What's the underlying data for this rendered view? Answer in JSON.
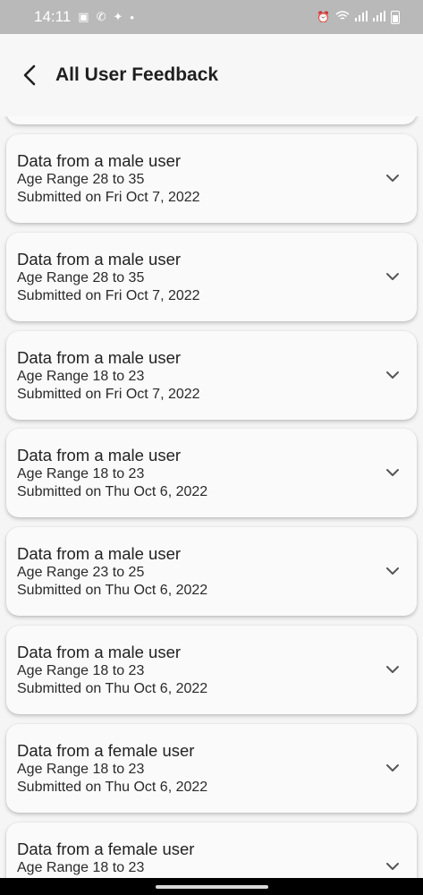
{
  "status_bar": {
    "time": "14:11",
    "left_icons": [
      "gallery-icon",
      "whatsapp-icon",
      "twitter-icon",
      "dot-icon"
    ],
    "right_icons": [
      "alarm-icon",
      "wifi-icon",
      "signal-icon",
      "signal-icon",
      "battery-charging-icon"
    ]
  },
  "app_bar": {
    "title": "All User Feedback",
    "back_icon": "chevron-left-icon"
  },
  "feedback_list": [
    {
      "title": "Data from a male user",
      "age": "Age Range 28 to 35",
      "date": "Submitted on Fri Oct 7, 2022"
    },
    {
      "title": "Data from a male user",
      "age": "Age Range 28 to 35",
      "date": "Submitted on Fri Oct 7, 2022"
    },
    {
      "title": "Data from a male user",
      "age": "Age Range 18 to 23",
      "date": "Submitted on Fri Oct 7, 2022"
    },
    {
      "title": "Data from a male user",
      "age": "Age Range 18 to 23",
      "date": "Submitted on Thu Oct 6, 2022"
    },
    {
      "title": "Data from a male user",
      "age": "Age Range 23 to 25",
      "date": "Submitted on Thu Oct 6, 2022"
    },
    {
      "title": "Data from a male user",
      "age": "Age Range 18 to 23",
      "date": "Submitted on Thu Oct 6, 2022"
    },
    {
      "title": "Data from a female user",
      "age": "Age Range 18 to 23",
      "date": "Submitted on Thu Oct 6, 2022"
    },
    {
      "title": "Data from a female user",
      "age": "Age Range 18 to 23",
      "date": ""
    }
  ]
}
